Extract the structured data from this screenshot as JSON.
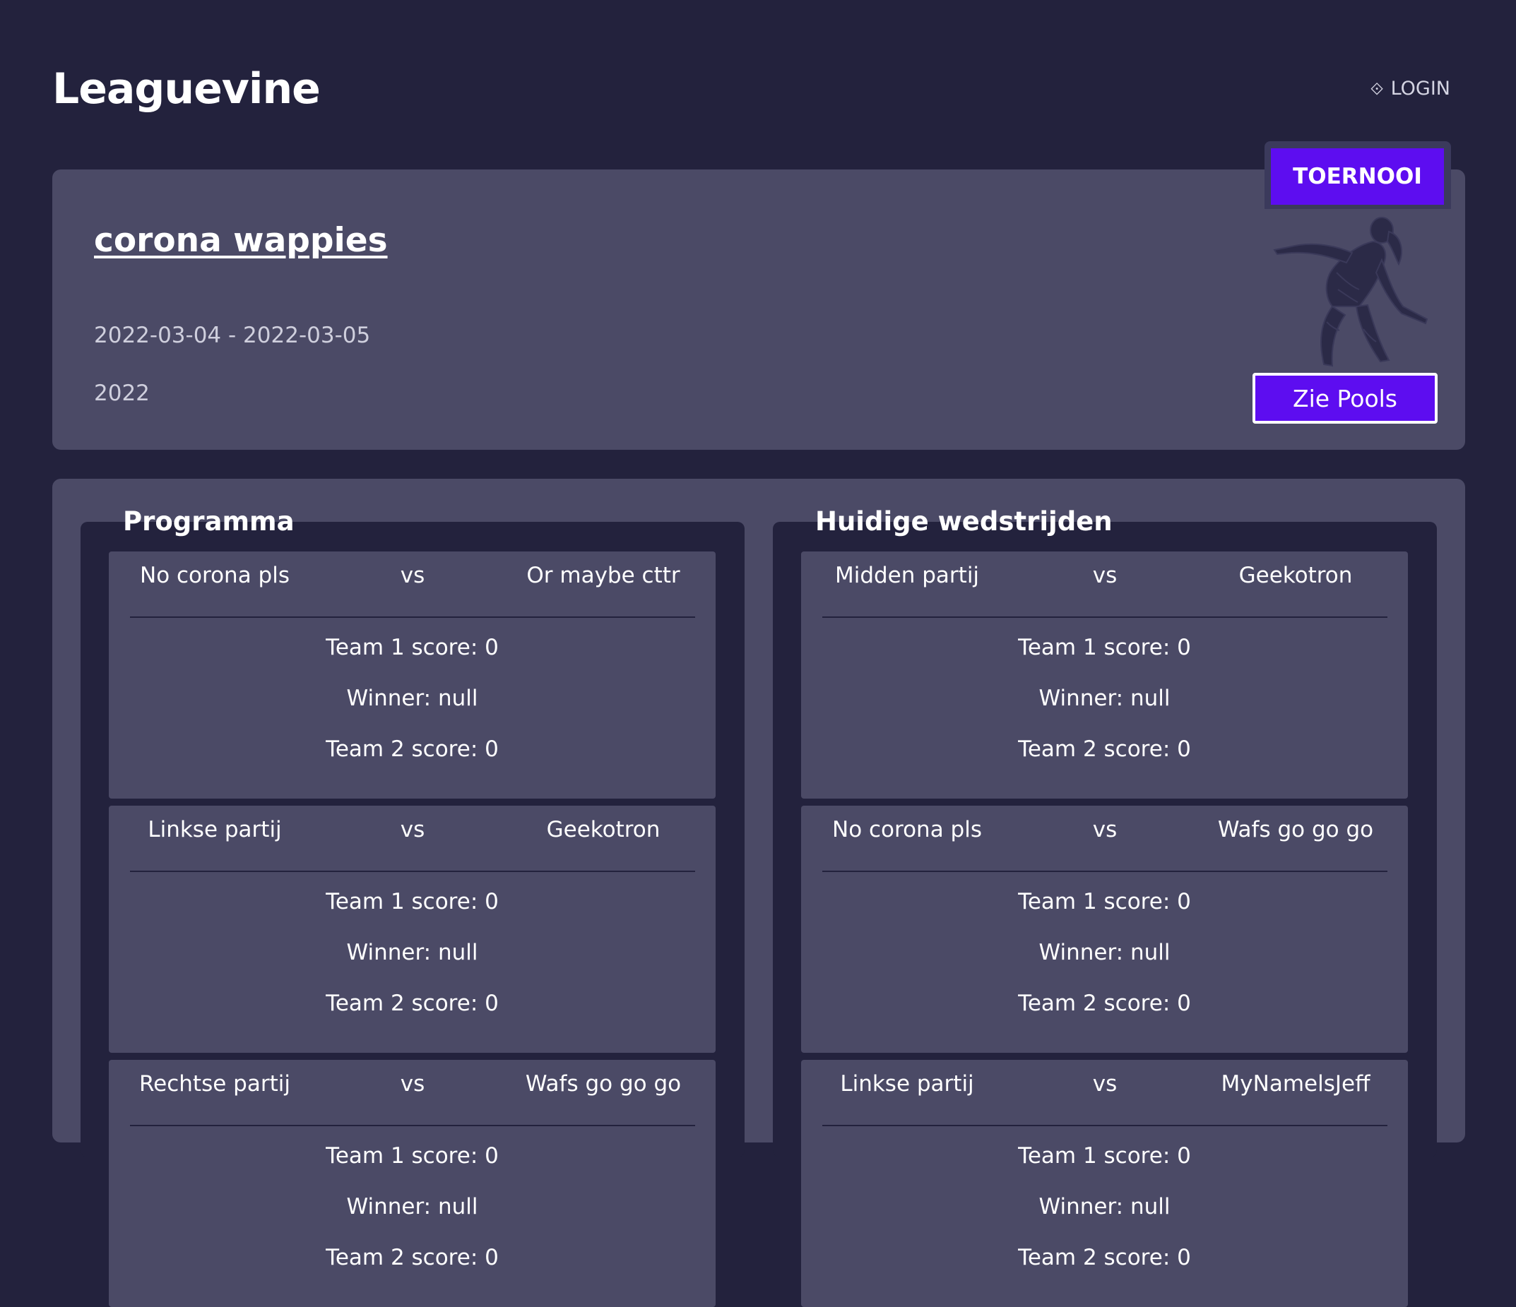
{
  "header": {
    "brand": "Leaguevine",
    "login_label": "LOGIN",
    "login_icon": "login-arrow-icon"
  },
  "tournament": {
    "name": "corona wappies",
    "dates": "2022-03-04 - 2022-03-05",
    "year": "2022",
    "badge": "TOERNOOI",
    "pools_button": "Zie Pools",
    "accent_color": "#5d0df0"
  },
  "program": {
    "title": "Programma",
    "matches": [
      {
        "team1": "No corona pls",
        "vs": "vs",
        "team2": "Or maybe cttr",
        "team1_score": "Team 1 score: 0",
        "winner": "Winner: null",
        "team2_score": "Team 2 score: 0"
      },
      {
        "team1": "Linkse partij",
        "vs": "vs",
        "team2": "Geekotron",
        "team1_score": "Team 1 score: 0",
        "winner": "Winner: null",
        "team2_score": "Team 2 score: 0"
      },
      {
        "team1": "Rechtse partij",
        "vs": "vs",
        "team2": "Wafs go go go",
        "team1_score": "Team 1 score: 0",
        "winner": "Winner: null",
        "team2_score": "Team 2 score: 0"
      }
    ]
  },
  "current": {
    "title": "Huidige wedstrijden",
    "matches": [
      {
        "team1": "Midden partij",
        "vs": "vs",
        "team2": "Geekotron",
        "team1_score": "Team 1 score: 0",
        "winner": "Winner: null",
        "team2_score": "Team 2 score: 0"
      },
      {
        "team1": "No corona pls",
        "vs": "vs",
        "team2": "Wafs go go go",
        "team1_score": "Team 1 score: 0",
        "winner": "Winner: null",
        "team2_score": "Team 2 score: 0"
      },
      {
        "team1": "Linkse partij",
        "vs": "vs",
        "team2": "MyNamelsJeff",
        "team1_score": "Team 1 score: 0",
        "winner": "Winner: null",
        "team2_score": "Team 2 score: 0"
      }
    ]
  }
}
